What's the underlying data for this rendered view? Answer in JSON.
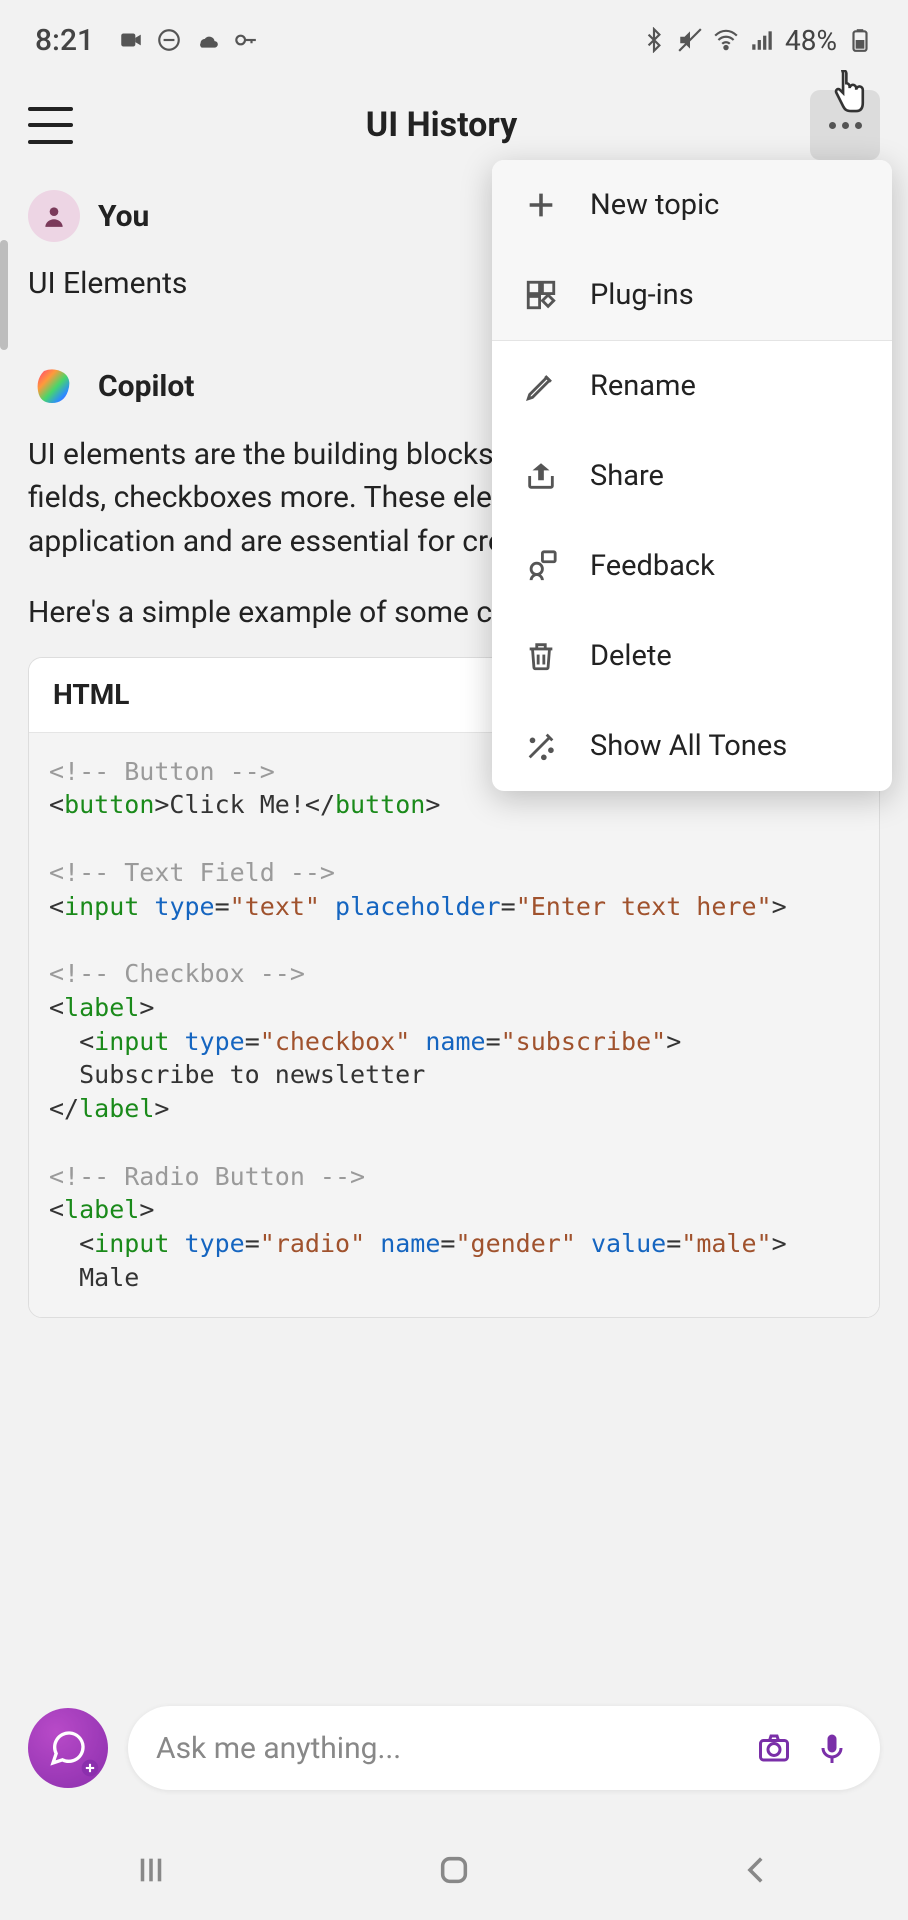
{
  "status": {
    "time": "8:21",
    "battery_pct": "48%"
  },
  "header": {
    "title": "UI History"
  },
  "chat": {
    "user_name": "You",
    "user_message": "UI Elements",
    "assistant_name": "Copilot",
    "assistant_para1": "UI elements are the building blocks of include buttons, text fields, checkboxes more. These elements help users inter application and are essential for creati friendly experience.",
    "assistant_para2": "Here's a simple example of some com."
  },
  "code": {
    "language": "HTML",
    "lines": {
      "c1": "<!-- Button -->",
      "l1a": "<",
      "l1b": "button",
      "l1c": ">Click Me!</",
      "l1d": "button",
      "l1e": ">",
      "c2": "<!-- Text Field -->",
      "l2a": "<",
      "l2b": "input",
      "l2sp1": " ",
      "l2c": "type",
      "l2d": "=",
      "l2e": "\"text\"",
      "l2sp2": " ",
      "l2f": "placeholder",
      "l2g": "=",
      "l2h": "\"Enter text here\"",
      "l2i": ">",
      "c3": "<!-- Checkbox -->",
      "l3a": "<",
      "l3b": "label",
      "l3c": ">",
      "l4a": "  <",
      "l4b": "input",
      "l4sp1": " ",
      "l4c": "type",
      "l4d": "=",
      "l4e": "\"checkbox\"",
      "l4sp2": " ",
      "l4f": "name",
      "l4g": "=",
      "l4h": "\"subscribe\"",
      "l4i": ">",
      "l5": "  Subscribe to newsletter",
      "l6a": "</",
      "l6b": "label",
      "l6c": ">",
      "c4": "<!-- Radio Button -->",
      "l7a": "<",
      "l7b": "label",
      "l7c": ">",
      "l8a": "  <",
      "l8b": "input",
      "l8sp1": " ",
      "l8c": "type",
      "l8d": "=",
      "l8e": "\"radio\"",
      "l8sp2": " ",
      "l8f": "name",
      "l8g": "=",
      "l8h": "\"gender\"",
      "l8sp3": " ",
      "l8i": "value",
      "l8j": "=",
      "l8k": "\"male\"",
      "l8l": ">",
      "l9": "  Male"
    }
  },
  "menu": {
    "new_topic": "New topic",
    "plugins": "Plug-ins",
    "rename": "Rename",
    "share": "Share",
    "feedback": "Feedback",
    "delete": "Delete",
    "show_all_tones": "Show All Tones"
  },
  "input": {
    "placeholder": "Ask me anything..."
  }
}
